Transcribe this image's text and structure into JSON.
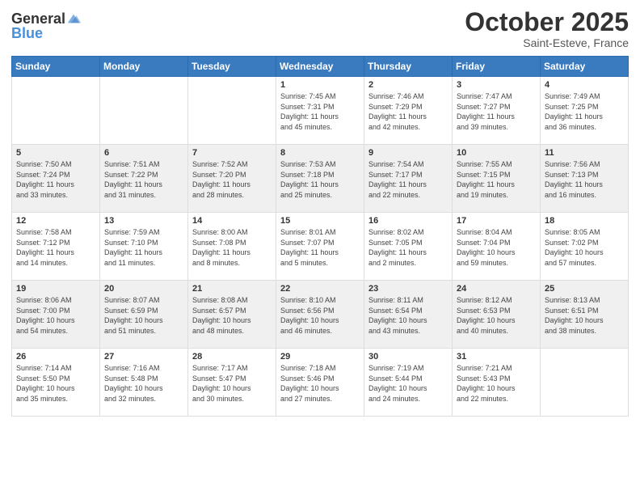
{
  "header": {
    "logo_general": "General",
    "logo_blue": "Blue",
    "month": "October 2025",
    "location": "Saint-Esteve, France"
  },
  "weekdays": [
    "Sunday",
    "Monday",
    "Tuesday",
    "Wednesday",
    "Thursday",
    "Friday",
    "Saturday"
  ],
  "rows": [
    {
      "style": "white",
      "cells": [
        {
          "day": "",
          "info": ""
        },
        {
          "day": "",
          "info": ""
        },
        {
          "day": "",
          "info": ""
        },
        {
          "day": "1",
          "info": "Sunrise: 7:45 AM\nSunset: 7:31 PM\nDaylight: 11 hours\nand 45 minutes."
        },
        {
          "day": "2",
          "info": "Sunrise: 7:46 AM\nSunset: 7:29 PM\nDaylight: 11 hours\nand 42 minutes."
        },
        {
          "day": "3",
          "info": "Sunrise: 7:47 AM\nSunset: 7:27 PM\nDaylight: 11 hours\nand 39 minutes."
        },
        {
          "day": "4",
          "info": "Sunrise: 7:49 AM\nSunset: 7:25 PM\nDaylight: 11 hours\nand 36 minutes."
        }
      ]
    },
    {
      "style": "gray",
      "cells": [
        {
          "day": "5",
          "info": "Sunrise: 7:50 AM\nSunset: 7:24 PM\nDaylight: 11 hours\nand 33 minutes."
        },
        {
          "day": "6",
          "info": "Sunrise: 7:51 AM\nSunset: 7:22 PM\nDaylight: 11 hours\nand 31 minutes."
        },
        {
          "day": "7",
          "info": "Sunrise: 7:52 AM\nSunset: 7:20 PM\nDaylight: 11 hours\nand 28 minutes."
        },
        {
          "day": "8",
          "info": "Sunrise: 7:53 AM\nSunset: 7:18 PM\nDaylight: 11 hours\nand 25 minutes."
        },
        {
          "day": "9",
          "info": "Sunrise: 7:54 AM\nSunset: 7:17 PM\nDaylight: 11 hours\nand 22 minutes."
        },
        {
          "day": "10",
          "info": "Sunrise: 7:55 AM\nSunset: 7:15 PM\nDaylight: 11 hours\nand 19 minutes."
        },
        {
          "day": "11",
          "info": "Sunrise: 7:56 AM\nSunset: 7:13 PM\nDaylight: 11 hours\nand 16 minutes."
        }
      ]
    },
    {
      "style": "white",
      "cells": [
        {
          "day": "12",
          "info": "Sunrise: 7:58 AM\nSunset: 7:12 PM\nDaylight: 11 hours\nand 14 minutes."
        },
        {
          "day": "13",
          "info": "Sunrise: 7:59 AM\nSunset: 7:10 PM\nDaylight: 11 hours\nand 11 minutes."
        },
        {
          "day": "14",
          "info": "Sunrise: 8:00 AM\nSunset: 7:08 PM\nDaylight: 11 hours\nand 8 minutes."
        },
        {
          "day": "15",
          "info": "Sunrise: 8:01 AM\nSunset: 7:07 PM\nDaylight: 11 hours\nand 5 minutes."
        },
        {
          "day": "16",
          "info": "Sunrise: 8:02 AM\nSunset: 7:05 PM\nDaylight: 11 hours\nand 2 minutes."
        },
        {
          "day": "17",
          "info": "Sunrise: 8:04 AM\nSunset: 7:04 PM\nDaylight: 10 hours\nand 59 minutes."
        },
        {
          "day": "18",
          "info": "Sunrise: 8:05 AM\nSunset: 7:02 PM\nDaylight: 10 hours\nand 57 minutes."
        }
      ]
    },
    {
      "style": "gray",
      "cells": [
        {
          "day": "19",
          "info": "Sunrise: 8:06 AM\nSunset: 7:00 PM\nDaylight: 10 hours\nand 54 minutes."
        },
        {
          "day": "20",
          "info": "Sunrise: 8:07 AM\nSunset: 6:59 PM\nDaylight: 10 hours\nand 51 minutes."
        },
        {
          "day": "21",
          "info": "Sunrise: 8:08 AM\nSunset: 6:57 PM\nDaylight: 10 hours\nand 48 minutes."
        },
        {
          "day": "22",
          "info": "Sunrise: 8:10 AM\nSunset: 6:56 PM\nDaylight: 10 hours\nand 46 minutes."
        },
        {
          "day": "23",
          "info": "Sunrise: 8:11 AM\nSunset: 6:54 PM\nDaylight: 10 hours\nand 43 minutes."
        },
        {
          "day": "24",
          "info": "Sunrise: 8:12 AM\nSunset: 6:53 PM\nDaylight: 10 hours\nand 40 minutes."
        },
        {
          "day": "25",
          "info": "Sunrise: 8:13 AM\nSunset: 6:51 PM\nDaylight: 10 hours\nand 38 minutes."
        }
      ]
    },
    {
      "style": "white",
      "cells": [
        {
          "day": "26",
          "info": "Sunrise: 7:14 AM\nSunset: 5:50 PM\nDaylight: 10 hours\nand 35 minutes."
        },
        {
          "day": "27",
          "info": "Sunrise: 7:16 AM\nSunset: 5:48 PM\nDaylight: 10 hours\nand 32 minutes."
        },
        {
          "day": "28",
          "info": "Sunrise: 7:17 AM\nSunset: 5:47 PM\nDaylight: 10 hours\nand 30 minutes."
        },
        {
          "day": "29",
          "info": "Sunrise: 7:18 AM\nSunset: 5:46 PM\nDaylight: 10 hours\nand 27 minutes."
        },
        {
          "day": "30",
          "info": "Sunrise: 7:19 AM\nSunset: 5:44 PM\nDaylight: 10 hours\nand 24 minutes."
        },
        {
          "day": "31",
          "info": "Sunrise: 7:21 AM\nSunset: 5:43 PM\nDaylight: 10 hours\nand 22 minutes."
        },
        {
          "day": "",
          "info": ""
        }
      ]
    }
  ]
}
